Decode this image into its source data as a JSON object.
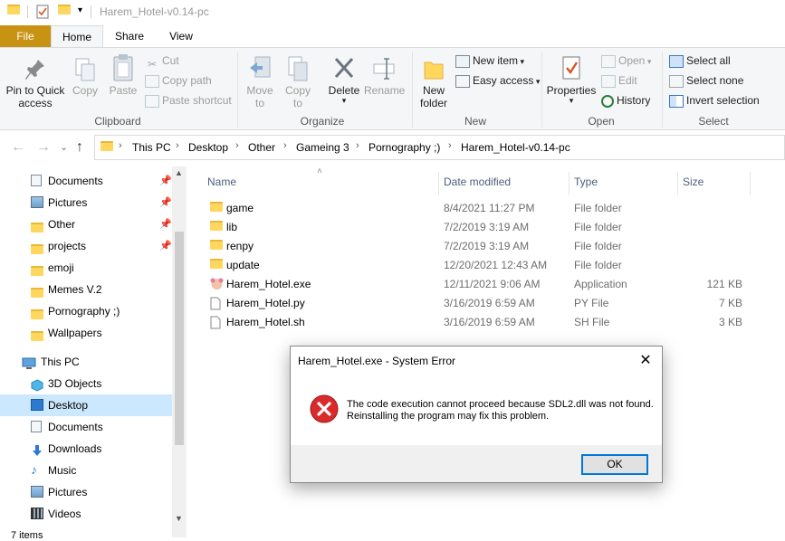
{
  "window": {
    "title": "Harem_Hotel-v0.14-pc"
  },
  "ribbon": {
    "tabs": {
      "file": "File",
      "home": "Home",
      "share": "Share",
      "view": "View"
    },
    "clipboard": {
      "label": "Clipboard",
      "pin_quick_access": [
        "Pin to Quick",
        "access"
      ],
      "copy": "Copy",
      "paste": "Paste",
      "cut": "Cut",
      "copy_path": "Copy path",
      "paste_shortcut": "Paste shortcut"
    },
    "organize": {
      "label": "Organize",
      "move_to": [
        "Move",
        "to"
      ],
      "copy_to": [
        "Copy",
        "to"
      ],
      "delete": "Delete",
      "rename": "Rename"
    },
    "new": {
      "label": "New",
      "new_folder": [
        "New",
        "folder"
      ],
      "new_item": "New item",
      "easy_access": "Easy access"
    },
    "open": {
      "label": "Open",
      "properties": "Properties",
      "open": "Open",
      "edit": "Edit",
      "history": "History"
    },
    "select": {
      "label": "Select",
      "select_all": "Select all",
      "select_none": "Select none",
      "invert_selection": "Invert selection"
    }
  },
  "breadcrumb": [
    "This PC",
    "Desktop",
    "Other",
    "Gameing 3",
    "Pornography ;)",
    "Harem_Hotel-v0.14-pc"
  ],
  "nav_pane": {
    "quick_access": [
      {
        "label": "Documents",
        "icon": "documents-icon",
        "pinned": true
      },
      {
        "label": "Pictures",
        "icon": "pictures-icon",
        "pinned": true
      },
      {
        "label": "Other",
        "icon": "folder-icon",
        "pinned": true
      },
      {
        "label": "projects",
        "icon": "folder-icon",
        "pinned": true
      },
      {
        "label": "emoji",
        "icon": "folder-icon",
        "pinned": false
      },
      {
        "label": "Memes V.2",
        "icon": "folder-icon",
        "pinned": false
      },
      {
        "label": "Pornography ;)",
        "icon": "folder-icon",
        "pinned": false
      },
      {
        "label": "Wallpapers",
        "icon": "folder-icon",
        "pinned": false
      }
    ],
    "this_pc": "This PC",
    "this_pc_items": [
      {
        "label": "3D Objects",
        "icon": "3d-objects-icon"
      },
      {
        "label": "Desktop",
        "icon": "desktop-icon",
        "selected": true
      },
      {
        "label": "Documents",
        "icon": "documents-icon"
      },
      {
        "label": "Downloads",
        "icon": "downloads-icon"
      },
      {
        "label": "Music",
        "icon": "music-icon"
      },
      {
        "label": "Pictures",
        "icon": "pictures-icon"
      },
      {
        "label": "Videos",
        "icon": "videos-icon"
      }
    ]
  },
  "file_list": {
    "columns": {
      "name": "Name",
      "date": "Date modified",
      "type": "Type",
      "size": "Size"
    },
    "rows": [
      {
        "name": "game",
        "date": "8/4/2021 11:27 PM",
        "type": "File folder",
        "size": "",
        "icon": "folder-icon"
      },
      {
        "name": "lib",
        "date": "7/2/2019 3:19 AM",
        "type": "File folder",
        "size": "",
        "icon": "folder-icon"
      },
      {
        "name": "renpy",
        "date": "7/2/2019 3:19 AM",
        "type": "File folder",
        "size": "",
        "icon": "folder-icon"
      },
      {
        "name": "update",
        "date": "12/20/2021 12:43 AM",
        "type": "File folder",
        "size": "",
        "icon": "folder-icon"
      },
      {
        "name": "Harem_Hotel.exe",
        "date": "12/11/2021 9:06 AM",
        "type": "Application",
        "size": "121 KB",
        "icon": "app-icon"
      },
      {
        "name": "Harem_Hotel.py",
        "date": "3/16/2019 6:59 AM",
        "type": "PY File",
        "size": "7 KB",
        "icon": "file-icon"
      },
      {
        "name": "Harem_Hotel.sh",
        "date": "3/16/2019 6:59 AM",
        "type": "SH File",
        "size": "3 KB",
        "icon": "file-icon"
      }
    ]
  },
  "dialog": {
    "title": "Harem_Hotel.exe - System Error",
    "message": "The code execution cannot proceed because SDL2.dll was not found. Reinstalling the program may fix this problem.",
    "ok": "OK",
    "close": "✕"
  },
  "status_bar": {
    "items": "7 items"
  },
  "colors": {
    "file_tab": "#c89213",
    "selected": "#cce8ff",
    "error": "#d92b2b",
    "folder": "#ffd75e"
  }
}
